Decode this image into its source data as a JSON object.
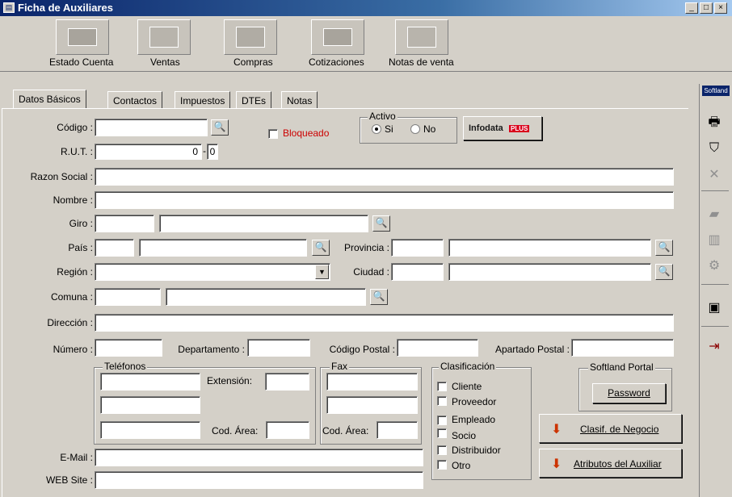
{
  "window": {
    "title": "Ficha de Auxiliares"
  },
  "toolbar": [
    {
      "label": "Estado Cuenta",
      "icon": "account-statement-icon"
    },
    {
      "label": "Ventas",
      "icon": "sales-icon"
    },
    {
      "label": "Compras",
      "icon": "purchases-icon"
    },
    {
      "label": "Cotizaciones",
      "icon": "quotes-icon"
    },
    {
      "label": "Notas de venta",
      "icon": "sales-notes-icon"
    }
  ],
  "tabs": [
    "Datos Básicos",
    "Contactos",
    "Impuestos",
    "DTEs",
    "Notas"
  ],
  "right_panel": {
    "title": "Softland"
  },
  "form": {
    "codigo_label": "Código :",
    "bloqueado_label": "Bloqueado",
    "activo": {
      "legend": "Activo",
      "si": "Si",
      "no": "No",
      "selected": "Si"
    },
    "infodata": "Infodata",
    "infodata_plus": "PLUS",
    "rut_label": "R.U.T. :",
    "rut_value": "0",
    "rut_dv": "0",
    "razon_social_label": "Razon Social :",
    "nombre_label": "Nombre :",
    "giro_label": "Giro :",
    "pais_label": "País :",
    "provincia_label": "Provincia :",
    "region_label": "Región :",
    "ciudad_label": "Ciudad :",
    "comuna_label": "Comuna :",
    "direccion_label": "Dirección :",
    "numero_label": "Número :",
    "departamento_label": "Departamento :",
    "codigo_postal_label": "Código Postal :",
    "apartado_postal_label": "Apartado Postal :",
    "telefonos": {
      "legend": "Teléfonos",
      "extension_label": "Extensión:",
      "cod_area_label": "Cod. Área:"
    },
    "fax": {
      "legend": "Fax",
      "cod_area_label": "Cod. Área:"
    },
    "clasificacion": {
      "legend": "Clasificación",
      "items": [
        "Cliente",
        "Proveedor",
        "Empleado",
        "Socio",
        "Distribuidor",
        "Otro"
      ]
    },
    "softland_portal": {
      "legend": "Softland Portal",
      "password_button": "Password"
    },
    "clasif_negocio_button": "Clasif. de Negocio",
    "atributos_button": "Atributos del Auxiliar",
    "email_label": "E-Mail :",
    "website_label": "WEB Site :"
  },
  "colors": {
    "title_bar": "#0a246a",
    "window_bg": "#d4d0c8",
    "field_bg": "#ffffff",
    "bloqueado_text": "#cc0000",
    "infodata_accent": "#d9001b"
  }
}
